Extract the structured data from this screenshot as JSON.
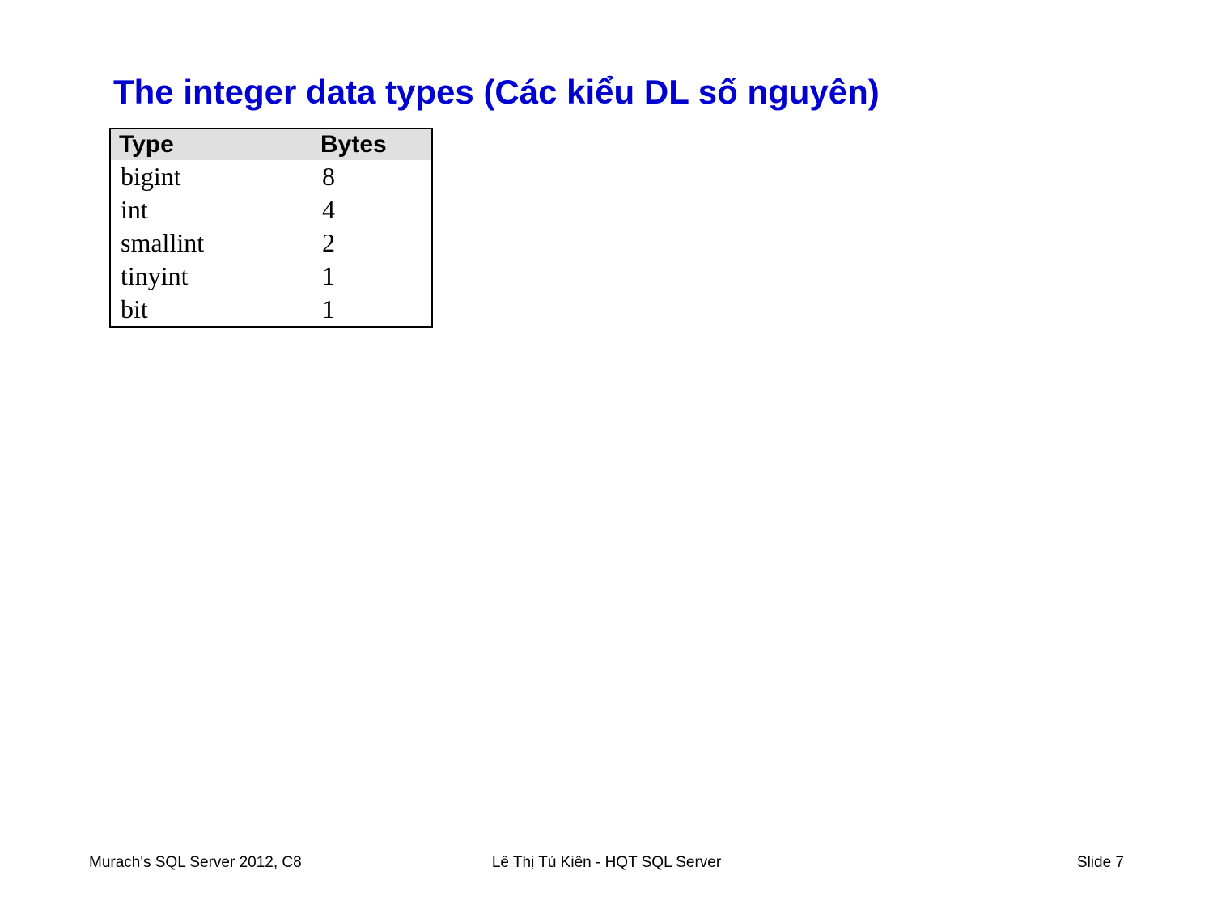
{
  "title": "The integer data types (Các kiểu DL số nguyên)",
  "table": {
    "headers": {
      "col1": "Type",
      "col2": "Bytes"
    },
    "rows": [
      {
        "type": "bigint",
        "bytes": "8"
      },
      {
        "type": "int",
        "bytes": "4"
      },
      {
        "type": "smallint",
        "bytes": "2"
      },
      {
        "type": "tinyint",
        "bytes": "1"
      },
      {
        "type": "bit",
        "bytes": "1"
      }
    ]
  },
  "footer": {
    "left": "Murach's SQL Server 2012, C8",
    "center": "Lê Thị Tú Kiên - HQT SQL Server",
    "right": "Slide 7"
  },
  "chart_data": {
    "type": "table",
    "title": "The integer data types (Các kiểu DL số nguyên)",
    "columns": [
      "Type",
      "Bytes"
    ],
    "rows": [
      [
        "bigint",
        8
      ],
      [
        "int",
        4
      ],
      [
        "smallint",
        2
      ],
      [
        "tinyint",
        1
      ],
      [
        "bit",
        1
      ]
    ]
  }
}
